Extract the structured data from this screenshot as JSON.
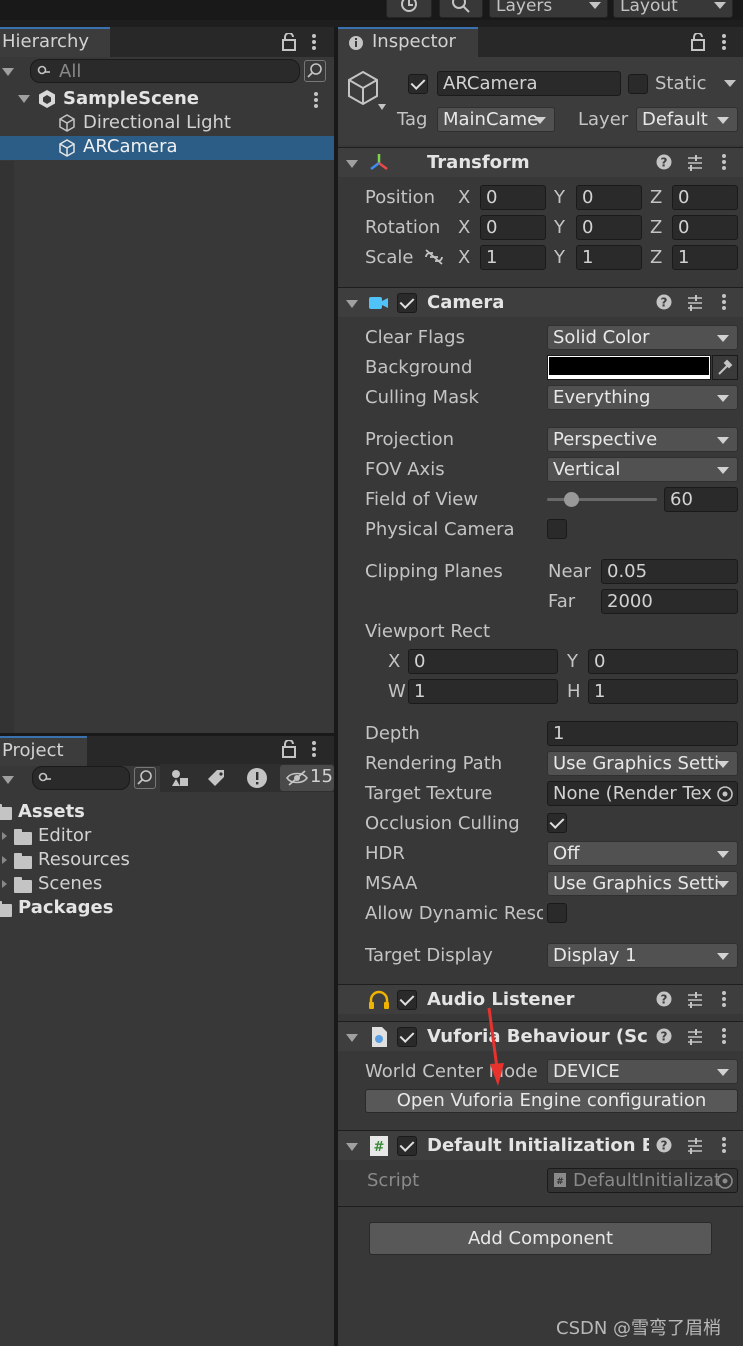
{
  "toolbar": {
    "layers": "Layers",
    "layout": "Layout"
  },
  "hierarchy": {
    "tab": "Hierarchy",
    "search_placeholder": "All",
    "scene": "SampleScene",
    "items": [
      "Directional Light",
      "ARCamera"
    ]
  },
  "project": {
    "tab": "Project",
    "hidden_count": "15",
    "tree": [
      "Assets",
      "Editor",
      "Resources",
      "Scenes",
      "Packages"
    ]
  },
  "inspector": {
    "tab": "Inspector",
    "object_name": "ARCamera",
    "static_label": "Static",
    "tag_label": "Tag",
    "tag_value": "MainCame",
    "layer_label": "Layer",
    "layer_value": "Default",
    "transform": {
      "title": "Transform",
      "rows": [
        {
          "label": "Position",
          "x": "0",
          "y": "0",
          "z": "0"
        },
        {
          "label": "Rotation",
          "x": "0",
          "y": "0",
          "z": "0"
        },
        {
          "label": "Scale",
          "x": "1",
          "y": "1",
          "z": "1"
        }
      ],
      "axes": [
        "X",
        "Y",
        "Z"
      ]
    },
    "camera": {
      "title": "Camera",
      "clear_flags": {
        "label": "Clear Flags",
        "value": "Solid Color"
      },
      "background": {
        "label": "Background",
        "color": "#000000"
      },
      "culling_mask": {
        "label": "Culling Mask",
        "value": "Everything"
      },
      "projection": {
        "label": "Projection",
        "value": "Perspective"
      },
      "fov_axis": {
        "label": "FOV Axis",
        "value": "Vertical"
      },
      "fov": {
        "label": "Field of View",
        "value": "60",
        "slider_fraction": 0.22
      },
      "physical": {
        "label": "Physical Camera"
      },
      "clipping": {
        "label": "Clipping Planes",
        "near_label": "Near",
        "near": "0.05",
        "far_label": "Far",
        "far": "2000"
      },
      "viewport": {
        "label": "Viewport Rect",
        "x_label": "X",
        "x": "0",
        "y_label": "Y",
        "y": "0",
        "w_label": "W",
        "w": "1",
        "h_label": "H",
        "h": "1"
      },
      "depth": {
        "label": "Depth",
        "value": "1"
      },
      "rendering_path": {
        "label": "Rendering Path",
        "value": "Use Graphics Setti"
      },
      "target_texture": {
        "label": "Target Texture",
        "value": "None (Render Tex"
      },
      "occlusion": {
        "label": "Occlusion Culling"
      },
      "hdr": {
        "label": "HDR",
        "value": "Off"
      },
      "msaa": {
        "label": "MSAA",
        "value": "Use Graphics Setti"
      },
      "dynamic_res": {
        "label": "Allow Dynamic Reso"
      },
      "target_display": {
        "label": "Target Display",
        "value": "Display 1"
      }
    },
    "audio_listener": {
      "title": "Audio Listener"
    },
    "vuforia": {
      "title": "Vuforia Behaviour (Scrip",
      "world_center_label": "World Center Mode",
      "world_center": "DEVICE",
      "open_button": "Open Vuforia Engine configuration"
    },
    "default_init": {
      "title": "Default Initialization Err",
      "script_label": "Script",
      "script_value": "DefaultInitializat"
    },
    "add_component": "Add Component"
  },
  "watermark": "CSDN @雪弯了眉梢",
  "colors": {
    "accent": "#2c5d87",
    "annotation_arrow": "#e8322d"
  }
}
